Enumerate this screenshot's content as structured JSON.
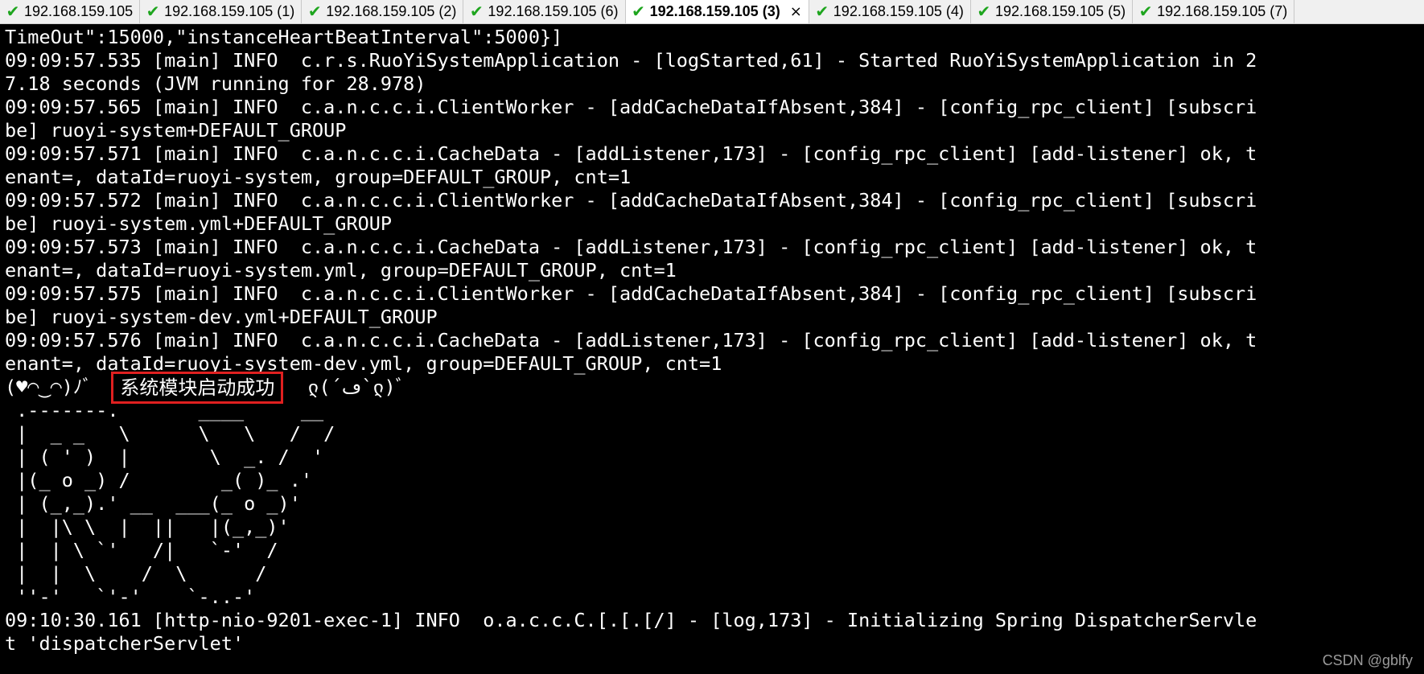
{
  "tabs": [
    {
      "label": "192.168.159.105",
      "active": false
    },
    {
      "label": "192.168.159.105 (1)",
      "active": false
    },
    {
      "label": "192.168.159.105 (2)",
      "active": false
    },
    {
      "label": "192.168.159.105 (6)",
      "active": false
    },
    {
      "label": "192.168.159.105 (3)",
      "active": true
    },
    {
      "label": "192.168.159.105 (4)",
      "active": false
    },
    {
      "label": "192.168.159.105 (5)",
      "active": false
    },
    {
      "label": "192.168.159.105 (7)",
      "active": false
    }
  ],
  "tab_icon": "check-icon",
  "tab_close_glyph": "×",
  "colors": {
    "check": "#1ea51e",
    "highlight_border": "#e02020",
    "terminal_bg": "#000000",
    "terminal_fg": "#ffffff"
  },
  "terminal": {
    "lines_before": [
      "TimeOut\":15000,\"instanceHeartBeatInterval\":5000}]",
      "09:09:57.535 [main] INFO  c.r.s.RuoYiSystemApplication - [logStarted,61] - Started RuoYiSystemApplication in 2",
      "7.18 seconds (JVM running for 28.978)",
      "09:09:57.565 [main] INFO  c.a.n.c.c.i.ClientWorker - [addCacheDataIfAbsent,384] - [config_rpc_client] [subscri",
      "be] ruoyi-system+DEFAULT_GROUP",
      "09:09:57.571 [main] INFO  c.a.n.c.c.i.CacheData - [addListener,173] - [config_rpc_client] [add-listener] ok, t",
      "enant=, dataId=ruoyi-system, group=DEFAULT_GROUP, cnt=1",
      "09:09:57.572 [main] INFO  c.a.n.c.c.i.ClientWorker - [addCacheDataIfAbsent,384] - [config_rpc_client] [subscri",
      "be] ruoyi-system.yml+DEFAULT_GROUP",
      "09:09:57.573 [main] INFO  c.a.n.c.c.i.CacheData - [addListener,173] - [config_rpc_client] [add-listener] ok, t",
      "enant=, dataId=ruoyi-system.yml, group=DEFAULT_GROUP, cnt=1",
      "09:09:57.575 [main] INFO  c.a.n.c.c.i.ClientWorker - [addCacheDataIfAbsent,384] - [config_rpc_client] [subscri",
      "be] ruoyi-system-dev.yml+DEFAULT_GROUP",
      "09:09:57.576 [main] INFO  c.a.n.c.c.i.CacheData - [addListener,173] - [config_rpc_client] [add-listener] ok, t",
      "enant=, dataId=ruoyi-system-dev.yml, group=DEFAULT_GROUP, cnt=1"
    ],
    "banner": {
      "prefix": "(♥◠‿◠)ﾉﾞ",
      "message": "系统模块启动成功",
      "suffix": "ლ(´ڡ`ლ)ﾞ"
    },
    "ascii_art": [
      " .-------.       ____     __",
      " |  _ _   \\      \\   \\   /  /",
      " | ( ' )  |       \\  _. /  '",
      " |(_ o _) /        _( )_ .'",
      " | (_,_).' __  ___(_ o _)'",
      " |  |\\ \\  |  ||   |(_,_)'",
      " |  | \\ `'   /|   `-'  /",
      " |  |  \\    /  \\      /",
      " ''-'   `'-'    `-..-'"
    ],
    "lines_after": [
      "09:10:30.161 [http-nio-9201-exec-1] INFO  o.a.c.c.C.[.[.[/] - [log,173] - Initializing Spring DispatcherServle",
      "t 'dispatcherServlet'"
    ]
  },
  "watermark": "CSDN @gblfy"
}
